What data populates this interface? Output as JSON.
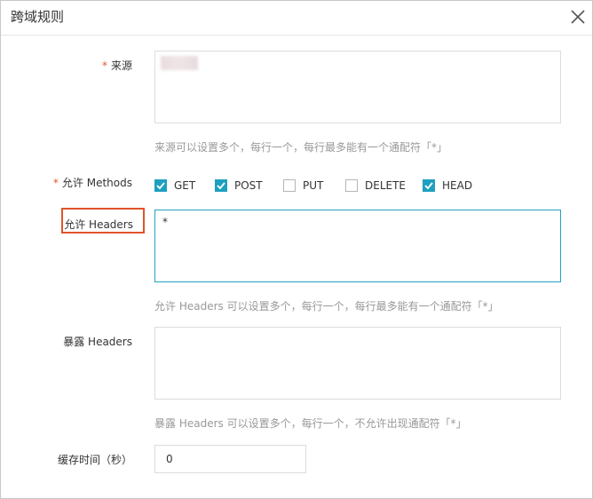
{
  "dialog": {
    "title": "跨域规则"
  },
  "form": {
    "origin": {
      "label": "来源",
      "required_mark": "*",
      "help": "来源可以设置多个，每行一个，每行最多能有一个通配符「*」"
    },
    "methods": {
      "label": "允许 Methods",
      "required_mark": "*",
      "options": [
        {
          "label": "GET",
          "checked": true
        },
        {
          "label": "POST",
          "checked": true
        },
        {
          "label": "PUT",
          "checked": false
        },
        {
          "label": "DELETE",
          "checked": false
        },
        {
          "label": "HEAD",
          "checked": true
        }
      ]
    },
    "allow_headers": {
      "label": "允许 Headers",
      "value": "*",
      "help": "允许 Headers 可以设置多个，每行一个，每行最多能有一个通配符「*」"
    },
    "expose_headers": {
      "label": "暴露 Headers",
      "value": "",
      "help": "暴露 Headers 可以设置多个，每行一个，不允许出现通配符「*」"
    },
    "cache_time": {
      "label": "缓存时间（秒）",
      "value": "0"
    }
  },
  "colors": {
    "accent": "#1ea0bf",
    "required": "#e8542f",
    "highlight": "#e0542a"
  },
  "icons": {
    "close": "close-icon",
    "check": "check-icon"
  }
}
